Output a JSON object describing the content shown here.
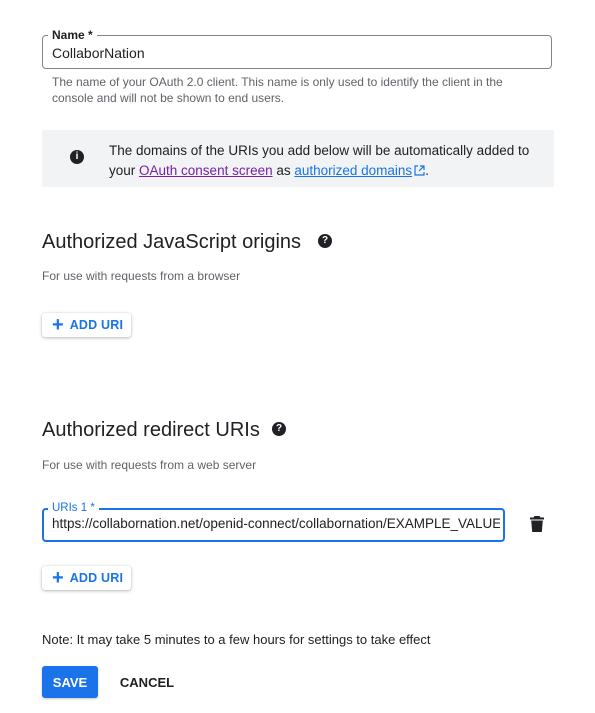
{
  "name_field": {
    "label": "Name *",
    "value": "CollaborNation",
    "helper": "The name of your OAuth 2.0 client. This name is only used to identify the client in the console and will not be shown to end users."
  },
  "info_callout": {
    "text_before": "The domains of the URIs you add below will be automatically added to your ",
    "consent_link": "OAuth consent screen",
    "text_middle": " as ",
    "domains_link": "authorized domains",
    "text_after": "."
  },
  "js_origins": {
    "title": "Authorized JavaScript origins",
    "subtitle": "For use with requests from a browser",
    "add_label": "ADD URI"
  },
  "redirect_uris": {
    "title": "Authorized redirect URIs",
    "subtitle": "For use with requests from a web server",
    "field_label": "URIs 1 *",
    "field_value": "https://collabornation.net/openid-connect/collabornation/EXAMPLE_VALUE_",
    "add_label": "ADD URI"
  },
  "note": "Note: It may take 5 minutes to a few hours for settings to take effect",
  "actions": {
    "save": "SAVE",
    "cancel": "CANCEL"
  },
  "colors": {
    "accent": "#1a73e8",
    "visited_link": "#7b1fa2",
    "callout_bg": "#f1f3f4"
  }
}
